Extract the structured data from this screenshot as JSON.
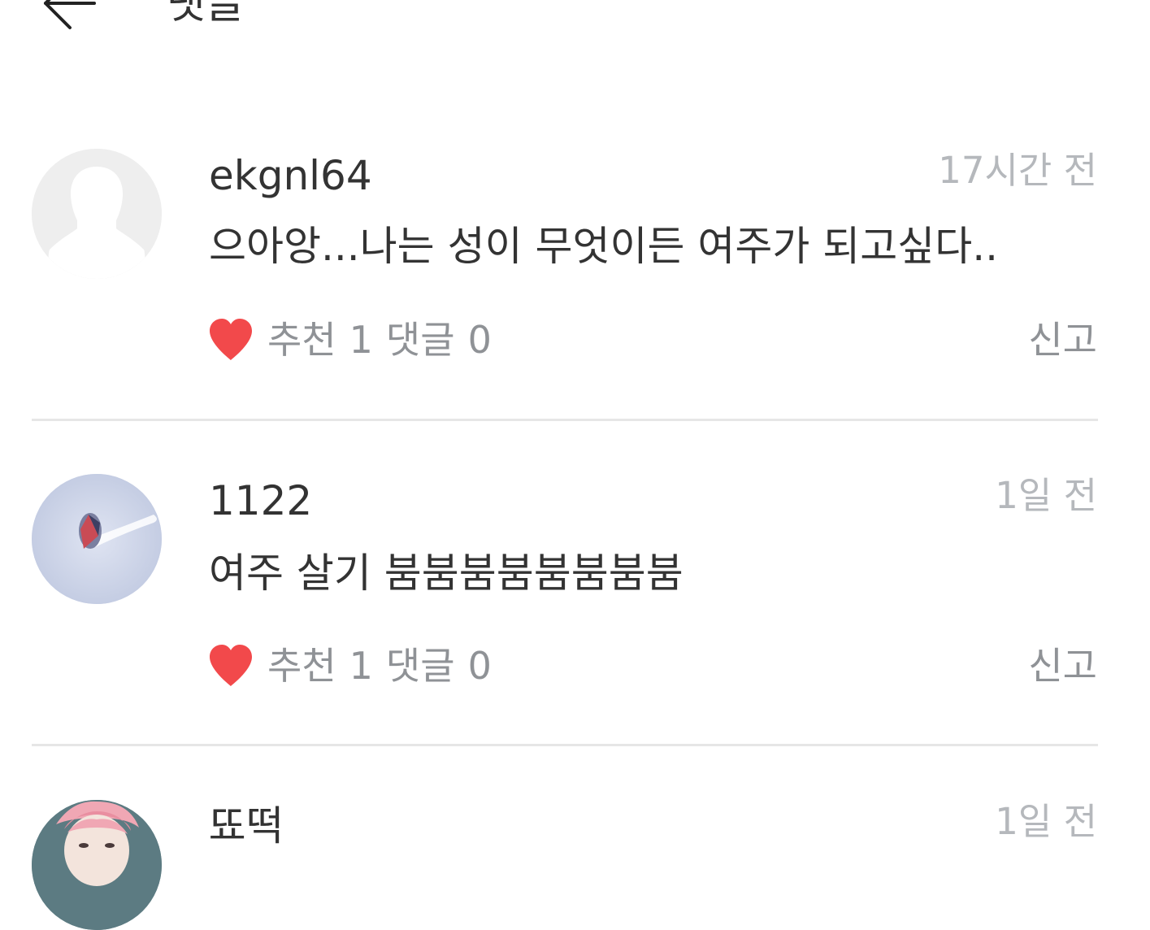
{
  "header": {
    "title": "댓글",
    "back_icon": "arrow-left-icon"
  },
  "colors": {
    "heart": "#f2494b",
    "muted_text": "#8f9296",
    "timestamp": "#b5b8bc",
    "divider": "#e6e6e6"
  },
  "comments": [
    {
      "username": "ekgnl64",
      "time": "17시간 전",
      "text": "으아앙...나는 성이 무엇이든 여주가 되고싶다..",
      "like_label": "추천",
      "like_count": "1",
      "reply_label": "댓글",
      "reply_count": "0",
      "report_label": "신고",
      "avatar": "default-avatar"
    },
    {
      "username": "1122",
      "time": "1일 전",
      "text": "여주 살기 붐붐붐붐붐붐붐붐",
      "like_label": "추천",
      "like_count": "1",
      "reply_label": "댓글",
      "reply_count": "0",
      "report_label": "신고",
      "avatar": "photo-avatar"
    },
    {
      "username": "뚀떡",
      "time": "1일 전",
      "avatar": "photo-avatar"
    }
  ]
}
